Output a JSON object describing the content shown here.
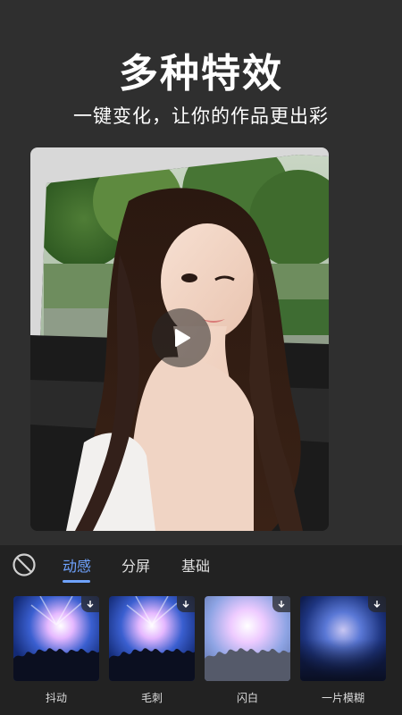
{
  "header": {
    "title": "多种特效",
    "subtitle": "一键变化，让你的作品更出彩"
  },
  "preview": {
    "image": "photo of a long-haired girl winking in a car",
    "play_icon": "play-icon"
  },
  "tabs": [
    {
      "label": "动感",
      "active": true
    },
    {
      "label": "分屏",
      "active": false
    },
    {
      "label": "基础",
      "active": false
    }
  ],
  "effects": [
    {
      "label": "抖动",
      "style": "concert-bright"
    },
    {
      "label": "毛刺",
      "style": "concert-bright"
    },
    {
      "label": "闪白",
      "style": "concert-washed"
    },
    {
      "label": "一片模糊",
      "style": "concert-blur"
    }
  ],
  "colors": {
    "background": "#2f2f2f",
    "panel": "#222222",
    "accent": "#6fa3ff"
  }
}
